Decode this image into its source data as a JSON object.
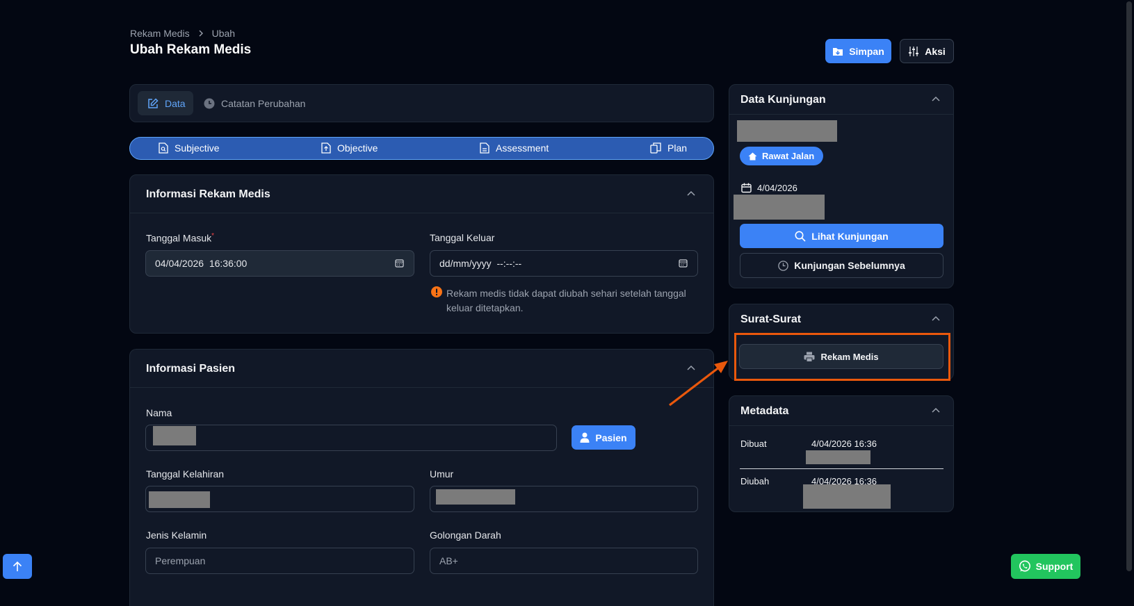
{
  "colors": {
    "background": "#030712",
    "card": "#111827",
    "primary": "#3b82f6",
    "soap_bar": "#2c5cb2",
    "warning": "#f97316",
    "success": "#22c55e",
    "highlight": "#ea580c"
  },
  "breadcrumb": {
    "parent": "Rekam Medis",
    "current": "Ubah"
  },
  "page_title": "Ubah Rekam Medis",
  "toolbar": {
    "save_label": "Simpan",
    "actions_label": "Aksi"
  },
  "tabs": [
    {
      "label": "Data",
      "icon": "edit-icon",
      "active": true
    },
    {
      "label": "Catatan Perubahan",
      "icon": "clock-icon",
      "active": false
    }
  ],
  "soap_tabs": [
    {
      "label": "Subjective",
      "icon": "document-search-icon"
    },
    {
      "label": "Objective",
      "icon": "document-upload-icon"
    },
    {
      "label": "Assessment",
      "icon": "document-icon"
    },
    {
      "label": "Plan",
      "icon": "clipboard-copy-icon"
    }
  ],
  "record_info": {
    "title": "Informasi Rekam Medis",
    "entry_date_label": "Tanggal Masuk",
    "required_mark": "*",
    "entry_date_value": "04/04/2026  16:36:00",
    "exit_date_label": "Tanggal Keluar",
    "exit_date_placeholder": "dd/mm/yyyy  --:--:--",
    "warning_line1": "Rekam medis tidak dapat diubah sehari setelah tanggal",
    "warning_line2": "keluar ditetapkan."
  },
  "patient_info": {
    "title": "Informasi Pasien",
    "name_label": "Nama",
    "patient_button": "Pasien",
    "birth_date_label": "Tanggal Kelahiran",
    "age_label": "Umur",
    "gender_label": "Jenis Kelamin",
    "gender_value": "Perempuan",
    "blood_type_label": "Golongan Darah",
    "blood_type_value": "AB+"
  },
  "visit": {
    "title": "Data Kunjungan",
    "type_badge": "Rawat Jalan",
    "date": "4/04/2026",
    "view_button": "Lihat Kunjungan",
    "previous_button": "Kunjungan Sebelumnya"
  },
  "letters": {
    "title": "Surat-Surat",
    "medical_record_button": "Rekam Medis"
  },
  "metadata": {
    "title": "Metadata",
    "created_label": "Dibuat",
    "created_value": "4/04/2026 16:36",
    "updated_label": "Diubah",
    "updated_value": "4/04/2026 16:36"
  },
  "support_label": "Support"
}
